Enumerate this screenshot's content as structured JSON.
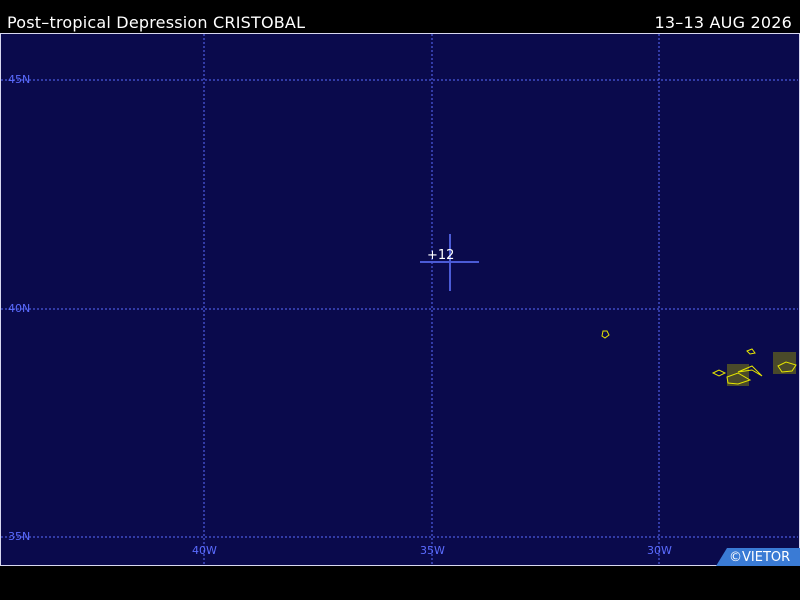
{
  "header": {
    "title": "Post–tropical Depression CRISTOBAL",
    "date": "13–13 AUG 2026"
  },
  "map": {
    "lat_labels": [
      "45N",
      "40N",
      "35N"
    ],
    "lon_labels": [
      "40W",
      "35W",
      "30W"
    ],
    "storm": {
      "label": "+12"
    },
    "credit": "©VIETOR",
    "colors": {
      "ocean": "#0a0a4c",
      "grid": "#5b6cff",
      "land": "#4a4a2a",
      "coast": "#e6e600",
      "track": "#4b5bd6"
    }
  }
}
